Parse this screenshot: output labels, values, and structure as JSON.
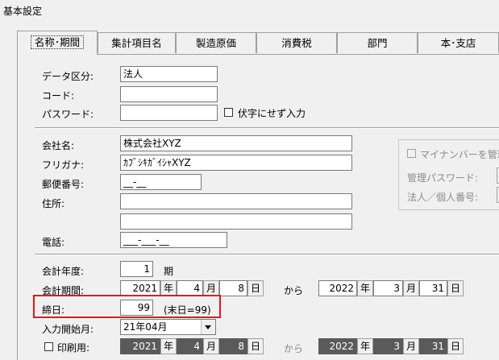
{
  "window": {
    "title": "基本設定"
  },
  "tabs": [
    {
      "label": "名称･期間",
      "active": true
    },
    {
      "label": "集計項目名",
      "active": false
    },
    {
      "label": "製造原価",
      "active": false
    },
    {
      "label": "消費税",
      "active": false
    },
    {
      "label": "部門",
      "active": false
    },
    {
      "label": "本･支店",
      "active": false
    }
  ],
  "data_section": {
    "data_kubun_label": "データ区分:",
    "data_kubun_value": "法人",
    "code_label": "コード:",
    "code_value": "",
    "password_label": "パスワード:",
    "password_value": "",
    "mask_checkbox_label": "伏字にせず入力"
  },
  "company": {
    "name_label": "会社名:",
    "name_value": "株式会社XYZ",
    "kana_label": "フリガナ:",
    "kana_value": "ｶﾌﾞｼｷｶﾞｲｼｬXYZ",
    "postal_label": "郵便番号:",
    "postal_value": "__-__",
    "address_label": "住所:",
    "address_line1": "",
    "address_line2": "",
    "phone_label": "電話:",
    "phone_value": "___-___-__"
  },
  "mynumber": {
    "checkbox_label": "マイナンバーを管理",
    "admin_password_label": "管理パスワード:",
    "corp_number_label": "法人／個人番号:"
  },
  "accounting": {
    "year_label": "会計年度:",
    "year_value": "1",
    "year_unit": "期",
    "period_label": "会計期間:",
    "from": {
      "year": "2021",
      "month": "4",
      "day": "8"
    },
    "from_word": "から",
    "to": {
      "year": "2022",
      "month": "3",
      "day": "31"
    },
    "unit_year": "年",
    "unit_month": "月",
    "unit_day": "日",
    "closing_label": "締日:",
    "closing_value": "99",
    "closing_note": "(末日=99)",
    "start_month_label": "入力開始月:",
    "start_month_value": "21年04月",
    "print_label": "印刷用:",
    "print_from": {
      "year": "2021",
      "month": "4",
      "day": "8"
    },
    "print_to": {
      "year": "2022",
      "month": "3",
      "day": "31"
    }
  },
  "colors": {
    "highlight_border": "#e8141c",
    "disabled_field": "#5a5a5a"
  }
}
